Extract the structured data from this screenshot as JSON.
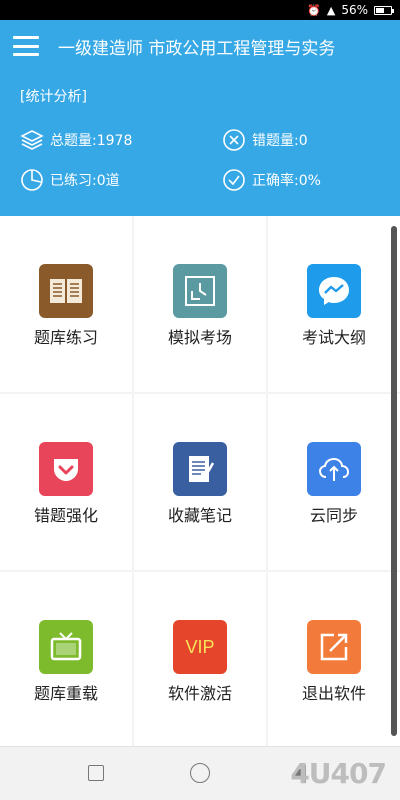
{
  "status_bar": {
    "battery": "56%",
    "battery_level": 0.56
  },
  "header": {
    "title": "一级建造师 市政公用工程管理与实务",
    "section": "[统计分析]",
    "stats": {
      "total": "总题量:1978",
      "wrong": "错题量:0",
      "practiced": "已练习:0道",
      "accuracy": "正确率:0%"
    }
  },
  "grid": {
    "items": [
      {
        "label": "题库练习",
        "color": "#8b5a2b"
      },
      {
        "label": "模拟考场",
        "color": "#5a9aa0"
      },
      {
        "label": "考试大纲",
        "color": "#1e9bea"
      },
      {
        "label": "错题强化",
        "color": "#e8445a"
      },
      {
        "label": "收藏笔记",
        "color": "#3a5fa0"
      },
      {
        "label": "云同步",
        "color": "#3d82e6"
      },
      {
        "label": "题库重载",
        "color": "#7dbb2d"
      },
      {
        "label": "软件激活",
        "color": "#e5452b",
        "badge": "VIP"
      },
      {
        "label": "退出软件",
        "color": "#f27a3a"
      }
    ]
  },
  "watermark": "4U407"
}
